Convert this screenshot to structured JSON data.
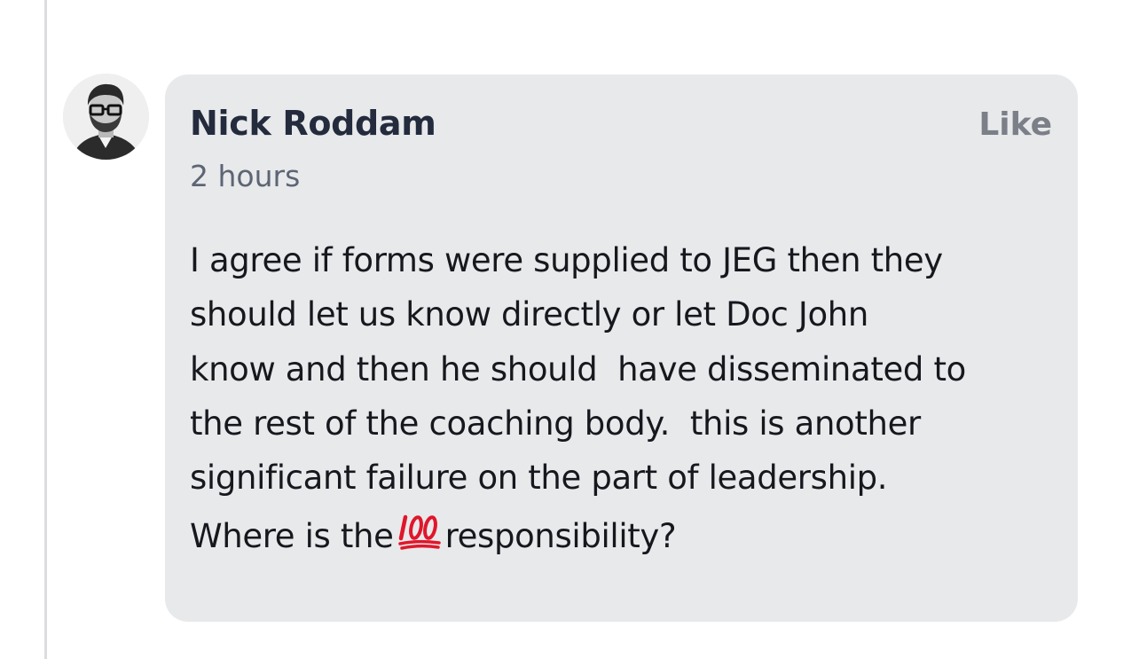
{
  "comment": {
    "author": "Nick Roddam",
    "time": "2 hours",
    "like_label": "Like",
    "body_lines": [
      "I agree if forms were supplied to JEG then they",
      "should let us know directly or let Doc John",
      "know and then he should  have disseminated to",
      "the rest of the coaching body.  this is another",
      "significant failure on the part of leadership."
    ],
    "last_line_before": "Where is the",
    "last_line_after": "responsibility?",
    "emoji": "hundred-points-emoji"
  },
  "colors": {
    "bubble": "#e8e9eb",
    "author": "#232b3d",
    "muted": "#5d6574",
    "like": "#7b7f87",
    "emoji_red": "#e0162b"
  }
}
